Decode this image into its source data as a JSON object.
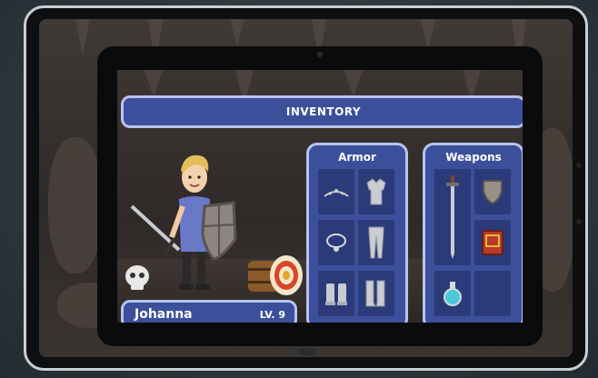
{
  "inventory": {
    "title": "INVENTORY",
    "armor": {
      "title": "Armor",
      "items": [
        {
          "icon": "tiara-icon"
        },
        {
          "icon": "chest-armor-icon"
        },
        {
          "icon": "necklace-icon"
        },
        {
          "icon": "leg-armor-icon"
        },
        {
          "icon": "gauntlets-icon"
        },
        {
          "icon": "boots-icon"
        }
      ]
    },
    "weapons": {
      "title": "Weapons",
      "items": [
        {
          "icon": "sword-icon"
        },
        {
          "icon": "shield-icon"
        },
        {
          "icon": "spellbook-icon"
        },
        {
          "icon": "potion-icon"
        },
        {
          "icon": "empty-slot"
        }
      ]
    }
  },
  "character": {
    "name": "Johanna",
    "level": "LV. 9"
  },
  "colors": {
    "panel": "#3c4f9a",
    "panel_border": "#b7c3ec",
    "slot": "#2b3a78"
  }
}
